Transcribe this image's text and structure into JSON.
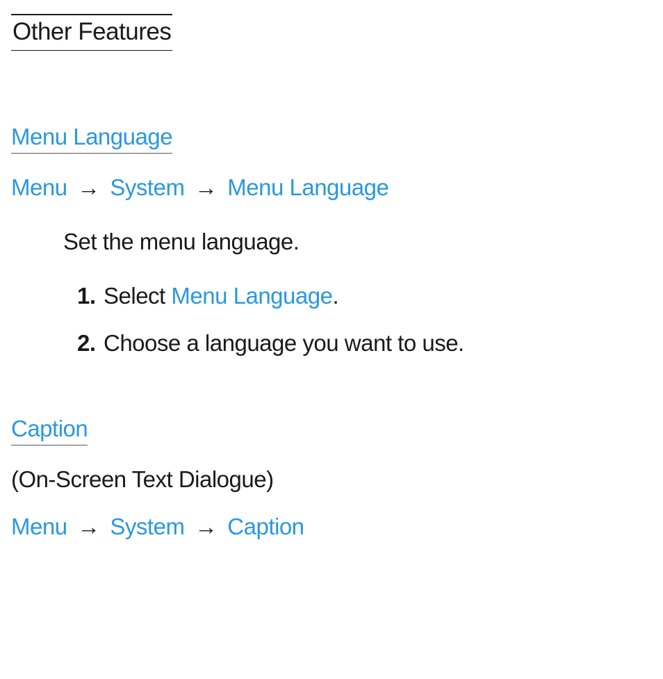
{
  "chapter": {
    "title": "Other Features"
  },
  "section1": {
    "heading": "Menu Language",
    "breadcrumb": {
      "item1": "Menu",
      "arrow1": "→",
      "item2": "System",
      "arrow2": "→",
      "item3": "Menu Language"
    },
    "body": "Set the menu language.",
    "steps": {
      "s1num": "1.",
      "s1a": "Select ",
      "s1b": "Menu Language",
      "s1c": ".",
      "s2num": "2.",
      "s2": "Choose a language you want to use."
    }
  },
  "section2": {
    "heading": "Caption",
    "subtext": "(On-Screen Text Dialogue)",
    "breadcrumb": {
      "item1": "Menu",
      "arrow1": "→",
      "item2": "System",
      "arrow2": "→",
      "item3": "Caption"
    }
  }
}
